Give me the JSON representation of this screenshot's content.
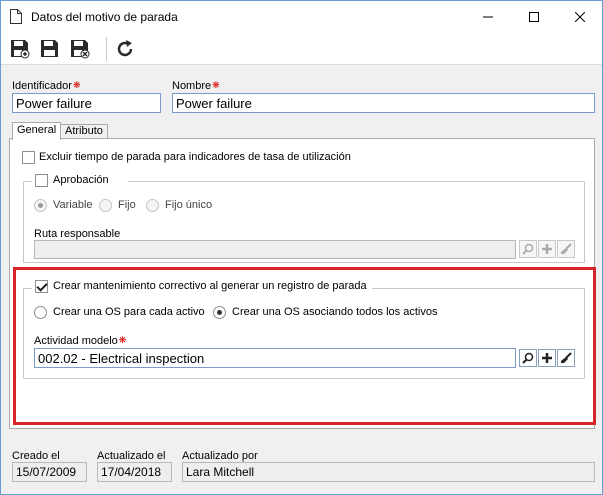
{
  "window": {
    "title": "Datos del motivo de parada"
  },
  "toolbar": {
    "buttons": [
      "save-new-icon",
      "save-icon",
      "save-close-icon",
      "refresh-icon"
    ]
  },
  "header": {
    "identifier_label": "Identificador",
    "identifier_value": "Power failure",
    "name_label": "Nombre",
    "name_value": "Power failure"
  },
  "tabs": [
    {
      "label": "General",
      "active": true
    },
    {
      "label": "Atributo",
      "active": false
    }
  ],
  "general": {
    "exclude_label": "Excluir tiempo de parada para indicadores de tasa de utilización",
    "exclude_checked": false,
    "approval_label": "Aprobación",
    "approval_checked": false,
    "approval_options": [
      "Variable",
      "Fijo",
      "Fijo único"
    ],
    "approval_selected": "Variable",
    "route_label": "Ruta responsable",
    "route_value": "",
    "maintenance_label": "Crear mantenimiento correctivo al generar un registro de parada",
    "maintenance_checked": true,
    "os_options": [
      "Crear una OS para cada activo",
      "Crear una OS asociando todos los activos"
    ],
    "os_selected": "Crear una OS asociando todos los activos",
    "activity_label": "Actividad modelo",
    "activity_value": "002.02 - Electrical inspection"
  },
  "footer": {
    "created_label": "Creado el",
    "created_value": "15/07/2009",
    "updated_label": "Actualizado el",
    "updated_value": "17/04/2018",
    "updated_by_label": "Actualizado por",
    "updated_by_value": "Lara Mitchell"
  },
  "colors": {
    "highlight": "#d7262b",
    "required": "#d90000",
    "field_border": "#7a9cc6"
  }
}
